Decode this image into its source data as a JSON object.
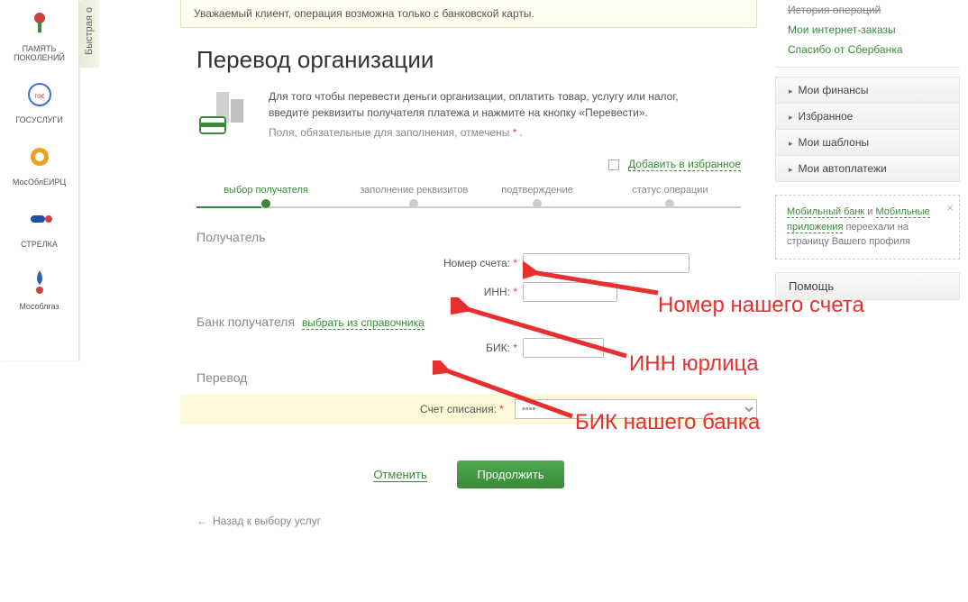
{
  "left_services": [
    {
      "label": "ПАМЯТЬ ПОКОЛЕНИЙ",
      "name": "service-memory"
    },
    {
      "label": "ГОСУСЛУГИ",
      "name": "service-gosuslugi"
    },
    {
      "label": "МосОблЕИРЦ",
      "name": "service-mosobleirc"
    },
    {
      "label": "СТРЕЛКА",
      "name": "service-strelka"
    },
    {
      "label": "Мособлгаз",
      "name": "service-mosoblgaz"
    }
  ],
  "quick_tab": "Быстрая о",
  "notice": "Уважаемый клиент, операция возможна только с банковской карты.",
  "page_title": "Перевод организации",
  "intro": {
    "line1": "Для того чтобы перевести деньги организации, оплатить товар, услугу или налог,",
    "line2": "введите реквизиты получателя платежа и нажмите на кнопку «Перевести».",
    "note": "Поля, обязательные для заполнения, отмечены ",
    "ast": "*",
    "period": " ."
  },
  "fav_link": "Добавить в избранное",
  "steps": [
    "выбор получателя",
    "заполнение реквизитов",
    "подтверждение",
    "статус операции"
  ],
  "sections": {
    "recipient": "Получатель",
    "bank": "Банк получателя",
    "transfer": "Перевод"
  },
  "bank_dir_link": "выбрать из справочника",
  "fields": {
    "account": "Номер счета:",
    "inn": "ИНН:",
    "bik": "БИК:",
    "debit": "Счет списания:"
  },
  "debit_placeholder": "••••",
  "actions": {
    "cancel": "Отменить",
    "continue": "Продолжить"
  },
  "back_link": "Назад к выбору услуг",
  "right": {
    "top_links": [
      {
        "label": "История операций",
        "struck": true
      },
      {
        "label": "Мои интернет-заказы",
        "struck": false
      },
      {
        "label": "Спасибо от Сбербанка",
        "struck": false
      }
    ],
    "accordion": [
      "Мои финансы",
      "Избранное",
      "Мои шаблоны",
      "Мои автоплатежи"
    ],
    "info": {
      "link1": "Мобильный банк",
      "and": " и ",
      "link2": "Мобильные приложения",
      "rest": " переехали на страницу Вашего профиля"
    },
    "help": "Помощь"
  },
  "annotations": {
    "account": "Номер  нашего счета",
    "inn": "ИНН юрлица",
    "bik": "БИК нашего банка"
  }
}
